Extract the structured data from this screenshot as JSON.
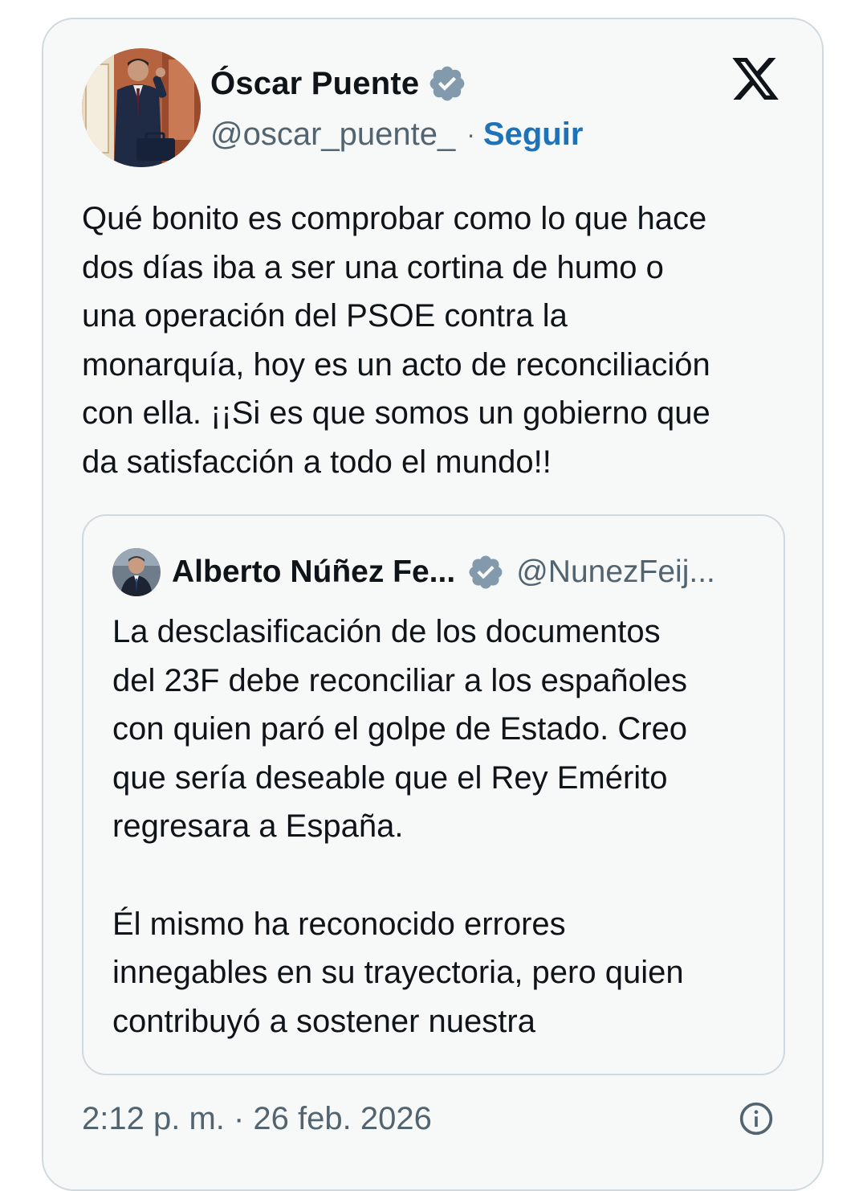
{
  "tweet": {
    "author": {
      "display_name": "Óscar Puente",
      "handle": "@oscar_puente_",
      "separator": "·",
      "follow_label": "Seguir"
    },
    "text": "Qué bonito es comprobar como lo que hace\ndos días iba a ser una cortina de humo o\nuna operación del PSOE contra la\nmonarquía, hoy es un acto de reconciliación\ncon ella. ¡¡Si es que somos un gobierno que\nda satisfacción a todo el mundo!!",
    "quoted": {
      "display_name": "Alberto Núñez Fe...",
      "handle": "@NunezFeij...",
      "text": "La desclasificación de los documentos\ndel 23F debe reconciliar a los españoles\ncon quien paró el golpe de Estado. Creo\nque sería deseable que el Rey Emérito\nregresara a España.\n\nÉl mismo ha reconocido errores\ninnegables en su trayectoria, pero quien\ncontribuyó a sostener nuestra"
    },
    "timestamp": "2:12 p. m. · 26 feb. 2026"
  },
  "icons": {
    "verified": "verified-badge-icon",
    "logo": "x-logo-icon",
    "info": "info-icon"
  },
  "colors": {
    "link_blue": "#1d72b8",
    "verified_gray": "#829aab",
    "muted_text": "#536471",
    "card_bg": "#f7f9f9",
    "border": "#cfd9de"
  }
}
